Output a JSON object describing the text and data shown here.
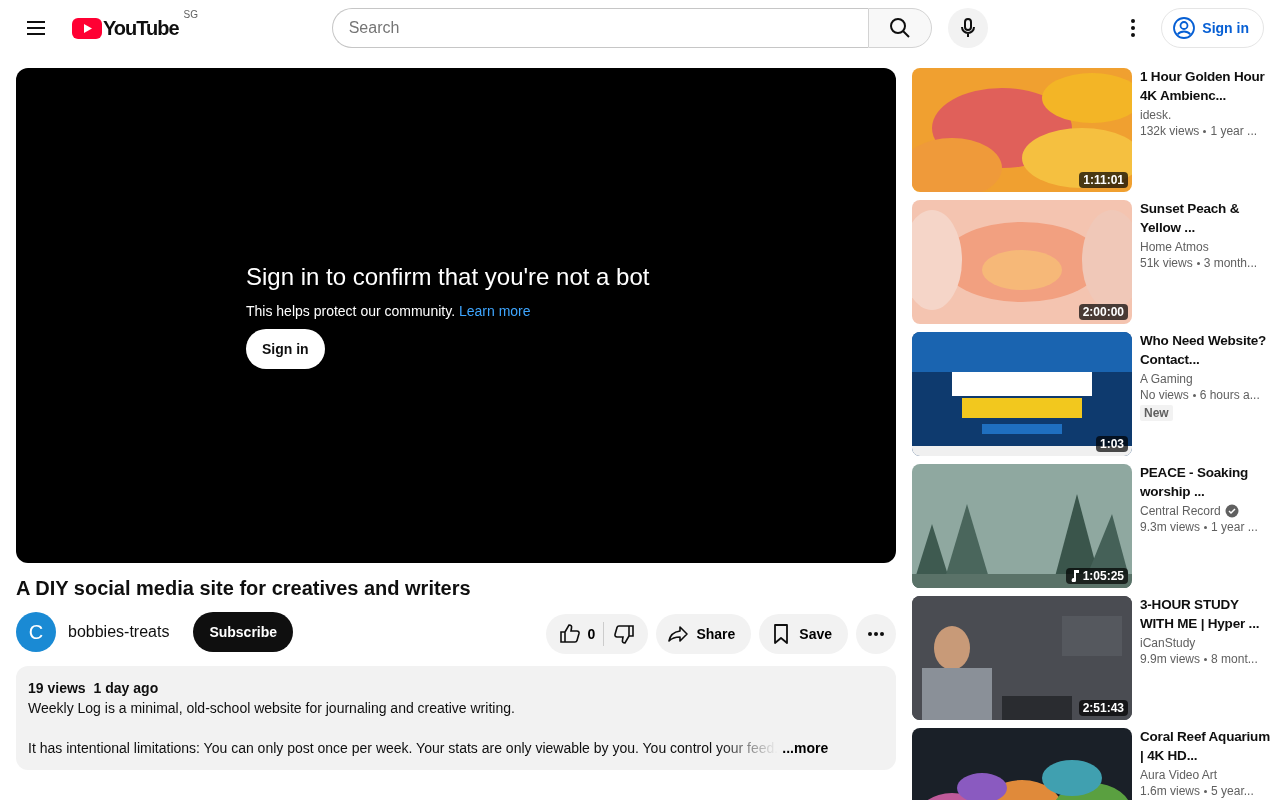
{
  "header": {
    "logo": "YouTube",
    "region": "SG",
    "search": {
      "placeholder": "Search"
    },
    "sign_in": "Sign in"
  },
  "player": {
    "heading": "Sign in to confirm that you're not a bot",
    "message": "This helps protect our community.",
    "link": "Learn more",
    "button": "Sign in"
  },
  "video": {
    "title": "A DIY social media site for creatives and writers",
    "channel": {
      "initial": "C",
      "name": "bobbies-treats"
    },
    "subscribe": "Subscribe",
    "likes": "0",
    "share": "Share",
    "save": "Save"
  },
  "description": {
    "views": "19 views",
    "date": "1 day ago",
    "lines": [
      "Weekly Log is a minimal, old-school website for journaling and creative writing.",
      "It has intentional limitations: You can only post once per week. Your stats are only viewable by you. You control your feed."
    ],
    "more": "...more"
  },
  "recommendations": [
    {
      "title": "1 Hour Golden Hour 4K Ambienc...",
      "channel": "idesk.",
      "verified": false,
      "views": "132k views",
      "age": "1 year ...",
      "duration": "1:11:01",
      "music": false
    },
    {
      "title": "Sunset Peach & Yellow ...",
      "channel": "Home Atmos",
      "verified": false,
      "views": "51k views",
      "age": "3 month...",
      "duration": "2:00:00",
      "music": false
    },
    {
      "title": "Who Need Website? Contact...",
      "channel": "A Gaming",
      "verified": false,
      "views": "No views",
      "age": "6 hours a...",
      "duration": "1:03",
      "music": false,
      "badge": "New"
    },
    {
      "title": "PEACE - Soaking worship ...",
      "channel": "Central Record",
      "verified": true,
      "views": "9.3m views",
      "age": "1 year ...",
      "duration": "1:05:25",
      "music": true
    },
    {
      "title": "3-HOUR STUDY WITH ME | Hyper ...",
      "channel": "iCanStudy",
      "verified": false,
      "views": "9.9m views",
      "age": "8 mont...",
      "duration": "2:51:43",
      "music": false
    },
    {
      "title": "Coral Reef Aquarium | 4K HD...",
      "channel": "Aura Video Art",
      "verified": false,
      "views": "1.6m views",
      "age": "5 year...",
      "music": false
    }
  ]
}
